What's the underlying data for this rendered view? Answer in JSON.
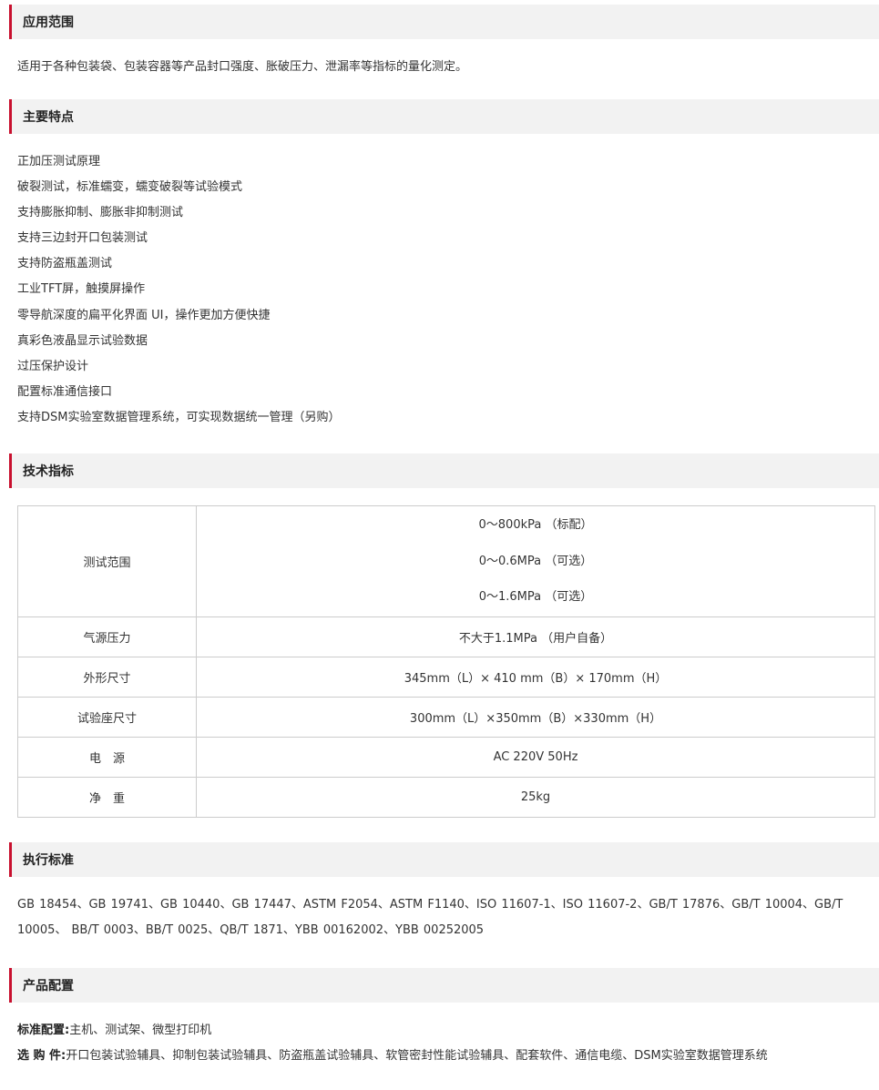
{
  "sections": {
    "scope": {
      "title": "应用范围",
      "text": "适用于各种包装袋、包装容器等产品封口强度、胀破压力、泄漏率等指标的量化测定。"
    },
    "features": {
      "title": "主要特点",
      "items": [
        "正加压测试原理",
        "破裂测试，标准蠕变，蠕变破裂等试验模式",
        "支持膨胀抑制、膨胀非抑制测试",
        "支持三边封开口包装测试",
        "支持防盗瓶盖测试",
        "工业TFT屏，触摸屏操作",
        "零导航深度的扁平化界面 UI，操作更加方便快捷",
        "真彩色液晶显示试验数据",
        "过压保护设计",
        "配置标准通信接口",
        "支持DSM实验室数据管理系统，可实现数据统一管理（另购）"
      ]
    },
    "specs": {
      "title": "技术指标",
      "rows": [
        {
          "label": "测试范围",
          "values": [
            "0～800kPa （标配）",
            "0～0.6MPa （可选）",
            "0～1.6MPa （可选）"
          ]
        },
        {
          "label": "气源压力",
          "values": [
            "不大于1.1MPa （用户自备）"
          ]
        },
        {
          "label": "外形尺寸",
          "values": [
            "345mm（L）× 410 mm（B）× 170mm（H）"
          ]
        },
        {
          "label": "试验座尺寸",
          "values": [
            "300mm（L）×350mm（B）×330mm（H）"
          ]
        },
        {
          "label": "电　源",
          "values": [
            "AC 220V 50Hz"
          ]
        },
        {
          "label": "净　重",
          "values": [
            "25kg"
          ]
        }
      ]
    },
    "standards": {
      "title": "执行标准",
      "text": "GB 18454、GB 19741、GB 10440、GB 17447、ASTM F2054、ASTM F1140、ISO 11607-1、ISO 11607-2、GB/T 17876、GB/T 10004、GB/T 10005、 BB/T 0003、BB/T 0025、QB/T 1871、YBB 00162002、YBB 00252005"
    },
    "config": {
      "title": "产品配置",
      "standard_label": "标准配置:",
      "standard_text": "主机、测试架、微型打印机",
      "optional_label": "选 购 件:",
      "optional_text": "开口包装试验辅具、抑制包装试验辅具、防盗瓶盖试验辅具、软管密封性能试验辅具、配套软件、通信电缆、DSM实验室数据管理系统"
    }
  },
  "colors": {
    "accent": "#c8102e",
    "header_bg": "#f2f2f2",
    "border": "#cccccc"
  }
}
